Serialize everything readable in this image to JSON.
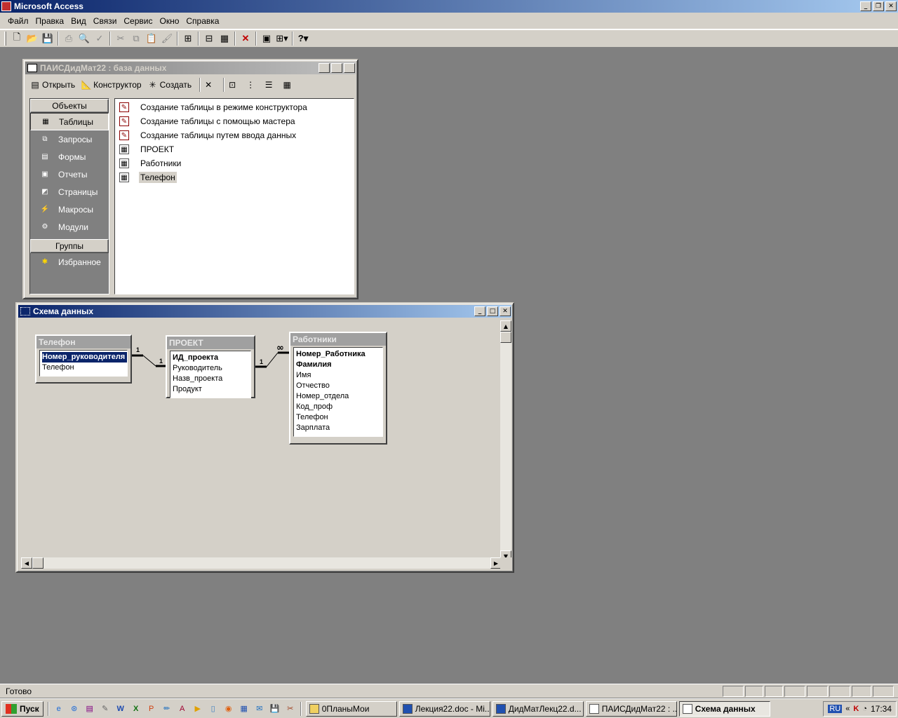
{
  "app": {
    "title": "Microsoft Access"
  },
  "menu": [
    {
      "label": "Файл"
    },
    {
      "label": "Правка"
    },
    {
      "label": "Вид"
    },
    {
      "label": "Связи"
    },
    {
      "label": "Сервис"
    },
    {
      "label": "Окно"
    },
    {
      "label": "Справка"
    }
  ],
  "db_window": {
    "title": "ПАИСДидМат22 : база данных",
    "toolbar": {
      "open": "Открыть",
      "design": "Конструктор",
      "create": "Создать"
    },
    "objects_header": "Объекты",
    "objects": [
      {
        "label": "Таблицы",
        "icon": "table-icon"
      },
      {
        "label": "Запросы",
        "icon": "query-icon"
      },
      {
        "label": "Формы",
        "icon": "form-icon"
      },
      {
        "label": "Отчеты",
        "icon": "report-icon"
      },
      {
        "label": "Страницы",
        "icon": "page-icon"
      },
      {
        "label": "Макросы",
        "icon": "macro-icon"
      },
      {
        "label": "Модули",
        "icon": "module-icon"
      }
    ],
    "groups_header": "Группы",
    "groups": [
      {
        "label": "Избранное",
        "icon": "favorites-icon"
      }
    ],
    "list": [
      {
        "label": "Создание таблицы в режиме конструктора",
        "icon": "wizard-icon"
      },
      {
        "label": "Создание таблицы с помощью мастера",
        "icon": "wizard-icon"
      },
      {
        "label": "Создание таблицы путем ввода данных",
        "icon": "wizard-icon"
      },
      {
        "label": "ПРОЕКТ",
        "icon": "table-icon"
      },
      {
        "label": "Работники",
        "icon": "table-icon"
      },
      {
        "label": "Телефон",
        "icon": "table-icon"
      }
    ]
  },
  "rel_window": {
    "title": "Схема данных",
    "tables": {
      "phone": {
        "title": "Телефон",
        "fields": [
          "Номер_руководителя",
          "Телефон"
        ]
      },
      "project": {
        "title": "ПРОЕКТ",
        "fields": [
          "ИД_проекта",
          "Руководитель",
          "Назв_проекта",
          "Продукт"
        ]
      },
      "workers": {
        "title": "Работники",
        "fields": [
          "Номер_Работника",
          "Фамилия",
          "Имя",
          "Отчество",
          "Номер_отдела",
          "Код_проф",
          "Телефон",
          "Зарплата"
        ]
      }
    },
    "relations": [
      {
        "from": "Телефон",
        "to": "ПРОЕКТ",
        "from_card": "1",
        "to_card": "1"
      },
      {
        "from": "ПРОЕКТ",
        "to": "Работники",
        "from_card": "1",
        "to_card": "∞"
      }
    ]
  },
  "status": {
    "text": "Готово"
  },
  "taskbar": {
    "start": "Пуск",
    "tasks": [
      {
        "label": "0ПланыМои"
      },
      {
        "label": "Лекция22.doc - Mi..."
      },
      {
        "label": "ДидМатЛекц22.d..."
      },
      {
        "label": "ПАИСДидМат22 : ..."
      },
      {
        "label": "Схема данных"
      }
    ],
    "lang": "RU",
    "time": "17:34"
  }
}
